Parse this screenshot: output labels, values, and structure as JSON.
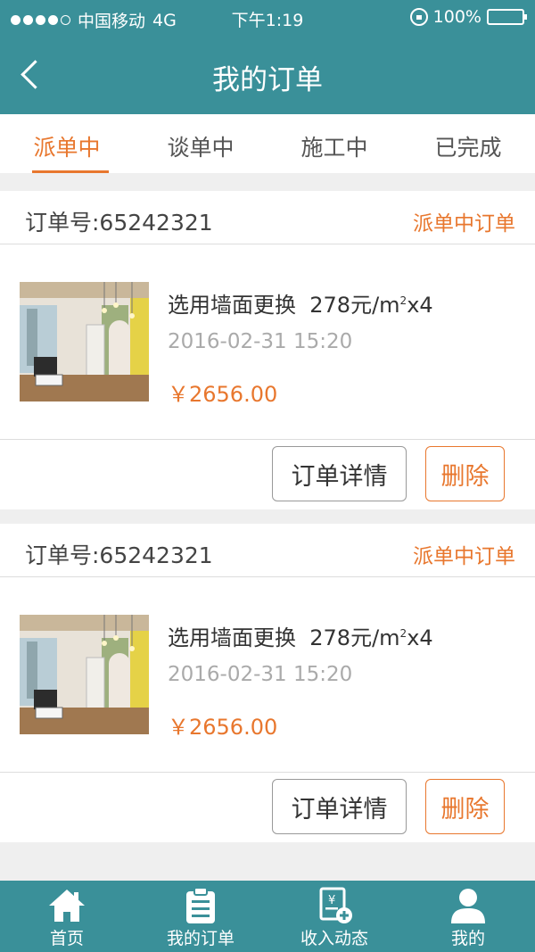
{
  "status_bar": {
    "carrier": "中国移动",
    "network": "4G",
    "time": "下午1:19",
    "battery": "100%"
  },
  "navbar": {
    "title": "我的订单"
  },
  "tabs": [
    {
      "label": "派单中",
      "active": true
    },
    {
      "label": "谈单中",
      "active": false
    },
    {
      "label": "施工中",
      "active": false
    },
    {
      "label": "已完成",
      "active": false
    }
  ],
  "orders": [
    {
      "order_no": "订单号:65242321",
      "status": "派单中订单",
      "product": "选用墙面更换",
      "unit_price": "278元/m",
      "unit_sup": "2",
      "qty": "x4",
      "date": "2016-02-31 15:20",
      "price": "￥2656.00",
      "detail_label": "订单详情",
      "delete_label": "删除"
    },
    {
      "order_no": "订单号:65242321",
      "status": "派单中订单",
      "product": "选用墙面更换",
      "unit_price": "278元/m",
      "unit_sup": "2",
      "qty": "x4",
      "date": "2016-02-31 15:20",
      "price": "￥2656.00",
      "detail_label": "订单详情",
      "delete_label": "删除"
    }
  ],
  "bottom_nav": [
    {
      "label": "首页",
      "icon": "home-icon"
    },
    {
      "label": "我的订单",
      "icon": "clipboard-icon"
    },
    {
      "label": "收入动态",
      "icon": "income-icon"
    },
    {
      "label": "我的",
      "icon": "user-icon"
    }
  ],
  "colors": {
    "primary": "#3a9099",
    "accent": "#e8772e"
  }
}
